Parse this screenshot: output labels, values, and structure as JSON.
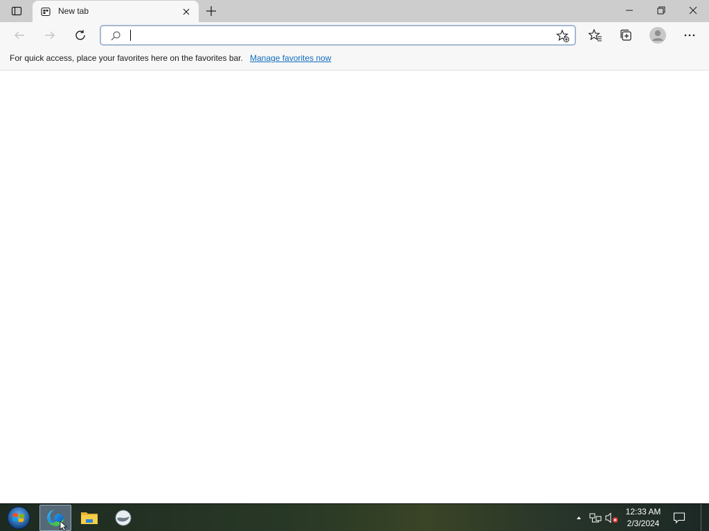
{
  "tabstrip": {
    "tab_actions_icon": "tab-actions-icon",
    "active_tab": {
      "title": "New tab",
      "favicon": "new-tab-page-icon"
    },
    "new_tab_icon": "plus-icon",
    "window_controls": [
      "minimize-icon",
      "restore-icon",
      "close-icon"
    ]
  },
  "toolbar": {
    "back_icon": "arrow-left-icon",
    "forward_icon": "arrow-right-icon",
    "refresh_icon": "refresh-icon",
    "address": {
      "value": "",
      "placeholder": ""
    },
    "add_favorite_icon": "star-add-icon",
    "favorites_icon": "favorites-icon",
    "collections_icon": "collections-icon",
    "profile_icon": "profile-avatar",
    "more_icon": "more-icon"
  },
  "favorites_bar": {
    "message": "For quick access, place your favorites here on the favorites bar.",
    "link": "Manage favorites now"
  },
  "taskbar": {
    "pinned": [
      "edge-icon",
      "file-explorer-icon",
      "app-icon"
    ],
    "active_item": "edge-icon",
    "clock": {
      "time": "12:33 AM",
      "date": "2/3/2024"
    },
    "tray": [
      "chevron-up-icon",
      "network-icon",
      "volume-muted-icon"
    ]
  },
  "colors": {
    "tabstrip_bg": "#cdcdcd",
    "toolbar_bg": "#f7f7f7",
    "link": "#0f6cbd",
    "omnibox_border": "#a3b8d3"
  }
}
